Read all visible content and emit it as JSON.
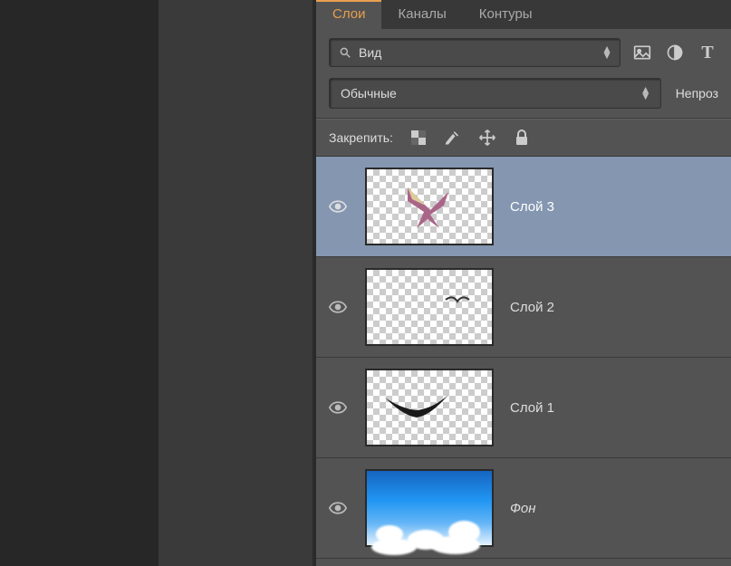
{
  "tabs": {
    "layers": "Слои",
    "channels": "Каналы",
    "paths": "Контуры"
  },
  "filter": {
    "label": "Вид"
  },
  "mode": {
    "label": "Обычные"
  },
  "opacity_label": "Непроз",
  "lock": {
    "label": "Закрепить:"
  },
  "layers": [
    {
      "name": "Слой 3",
      "visible": true,
      "selected": true,
      "kind": "bird-color",
      "bg": false
    },
    {
      "name": "Слой 2",
      "visible": true,
      "selected": false,
      "kind": "bird-small",
      "bg": false
    },
    {
      "name": "Слой 1",
      "visible": true,
      "selected": false,
      "kind": "bird-black",
      "bg": false
    },
    {
      "name": "Фон",
      "visible": true,
      "selected": false,
      "kind": "sky",
      "bg": true
    }
  ]
}
